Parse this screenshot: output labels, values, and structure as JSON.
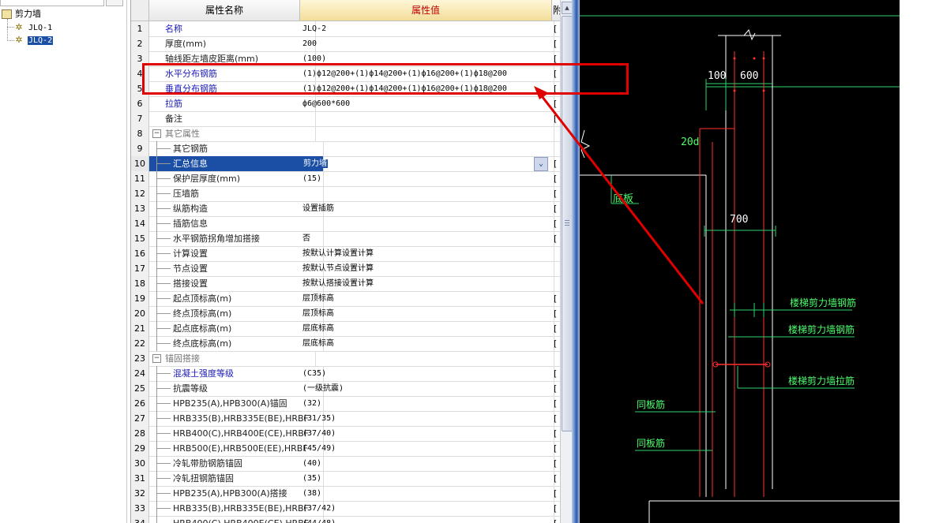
{
  "tree": {
    "root": "剪力墙",
    "children": [
      {
        "label": "JLQ-1",
        "selected": false
      },
      {
        "label": "JLQ-2",
        "selected": true
      }
    ]
  },
  "grid": {
    "headers": {
      "num": "",
      "name": "属性名称",
      "value": "属性值",
      "attach": "附"
    },
    "rows": [
      {
        "n": "1",
        "name": "名称",
        "value": "JLQ-2",
        "style": "blue",
        "level": 0,
        "attach": "["
      },
      {
        "n": "2",
        "name": "厚度(mm)",
        "value": "200",
        "style": "black",
        "level": 0,
        "attach": "["
      },
      {
        "n": "3",
        "name": "轴线距左墙皮距离(mm)",
        "value": "(100)",
        "style": "black",
        "level": 0,
        "attach": "["
      },
      {
        "n": "4",
        "name": "水平分布钢筋",
        "value": "(1)ф12@200+(1)ф14@200+(1)ф16@200+(1)ф18@200",
        "style": "blue",
        "level": 0,
        "attach": "["
      },
      {
        "n": "5",
        "name": "垂直分布钢筋",
        "value": "(1)ф12@200+(1)ф14@200+(1)ф16@200+(1)ф18@200",
        "style": "blue",
        "level": 0,
        "attach": "["
      },
      {
        "n": "6",
        "name": "拉筋",
        "value": "ф6@600*600",
        "style": "blue",
        "level": 0,
        "attach": "["
      },
      {
        "n": "7",
        "name": "备注",
        "value": "",
        "style": "black",
        "level": 0,
        "attach": "["
      },
      {
        "n": "8",
        "name": "其它属性",
        "value": "",
        "style": "gray",
        "level": -1,
        "attach": ""
      },
      {
        "n": "9",
        "name": "其它钢筋",
        "value": "",
        "style": "black",
        "level": 1,
        "attach": ""
      },
      {
        "n": "10",
        "name": "汇总信息",
        "value": "剪力墙",
        "style": "black",
        "level": 1,
        "attach": "[",
        "selected": true
      },
      {
        "n": "11",
        "name": "保护层厚度(mm)",
        "value": "(15)",
        "style": "black",
        "level": 1,
        "attach": "["
      },
      {
        "n": "12",
        "name": "压墙筋",
        "value": "",
        "style": "black",
        "level": 1,
        "attach": "["
      },
      {
        "n": "13",
        "name": "纵筋构造",
        "value": "设置插筋",
        "style": "black",
        "level": 1,
        "attach": "["
      },
      {
        "n": "14",
        "name": "插筋信息",
        "value": "",
        "style": "black",
        "level": 1,
        "attach": "["
      },
      {
        "n": "15",
        "name": "水平钢筋拐角增加搭接",
        "value": "否",
        "style": "black",
        "level": 1,
        "attach": "["
      },
      {
        "n": "16",
        "name": "计算设置",
        "value": "按默认计算设置计算",
        "style": "black",
        "level": 1,
        "attach": ""
      },
      {
        "n": "17",
        "name": "节点设置",
        "value": "按默认节点设置计算",
        "style": "black",
        "level": 1,
        "attach": ""
      },
      {
        "n": "18",
        "name": "搭接设置",
        "value": "按默认搭接设置计算",
        "style": "black",
        "level": 1,
        "attach": ""
      },
      {
        "n": "19",
        "name": "起点顶标高(m)",
        "value": "层顶标高",
        "style": "black",
        "level": 1,
        "attach": "["
      },
      {
        "n": "20",
        "name": "终点顶标高(m)",
        "value": "层顶标高",
        "style": "black",
        "level": 1,
        "attach": "["
      },
      {
        "n": "21",
        "name": "起点底标高(m)",
        "value": "层底标高",
        "style": "black",
        "level": 1,
        "attach": "["
      },
      {
        "n": "22",
        "name": "终点底标高(m)",
        "value": "层底标高",
        "style": "black",
        "level": 1,
        "attach": "["
      },
      {
        "n": "23",
        "name": "锚固搭接",
        "value": "",
        "style": "gray",
        "level": -1,
        "attach": ""
      },
      {
        "n": "24",
        "name": "混凝土强度等级",
        "value": "(C35)",
        "style": "blue",
        "level": 1,
        "attach": "["
      },
      {
        "n": "25",
        "name": "抗震等级",
        "value": "(一级抗震)",
        "style": "black",
        "level": 1,
        "attach": "["
      },
      {
        "n": "26",
        "name": "HPB235(A),HPB300(A)锚固",
        "value": "(32)",
        "style": "black",
        "level": 1,
        "attach": "["
      },
      {
        "n": "27",
        "name": "HRB335(B),HRB335E(BE),HRBF",
        "value": "(31/35)",
        "style": "black",
        "level": 1,
        "attach": "["
      },
      {
        "n": "28",
        "name": "HRB400(C),HRB400E(CE),HRBF",
        "value": "(37/40)",
        "style": "black",
        "level": 1,
        "attach": "["
      },
      {
        "n": "29",
        "name": "HRB500(E),HRB500E(EE),HRBF",
        "value": "(45/49)",
        "style": "black",
        "level": 1,
        "attach": "["
      },
      {
        "n": "30",
        "name": "冷轧带肋钢筋锚固",
        "value": "(40)",
        "style": "black",
        "level": 1,
        "attach": "["
      },
      {
        "n": "31",
        "name": "冷轧扭钢筋锚固",
        "value": "(35)",
        "style": "black",
        "level": 1,
        "attach": "["
      },
      {
        "n": "32",
        "name": "HPB235(A),HPB300(A)搭接",
        "value": "(38)",
        "style": "black",
        "level": 1,
        "attach": "["
      },
      {
        "n": "33",
        "name": "HRB335(B),HRB335E(BE),HRBF",
        "value": "(37/42)",
        "style": "black",
        "level": 1,
        "attach": "["
      },
      {
        "n": "34",
        "name": "HRB400(C),HRB400E(CE),HRBF",
        "value": "(44/48)",
        "style": "black",
        "level": 1,
        "attach": "["
      }
    ]
  },
  "cad": {
    "dim_100": "100",
    "dim_600": "600",
    "dim_20d": "20d",
    "label_floor": "底板",
    "dim_700": "700",
    "note_1": "楼梯剪力墙钢筋",
    "note_2": "楼梯剪力墙钢筋",
    "note_3": "楼梯剪力墙拉筋",
    "note_4": "同板筋",
    "note_5": "同板筋"
  },
  "colors": {
    "selection": "#1b4fa6",
    "highlight_box": "#e00000",
    "cad_bg": "#000000",
    "cad_text": "#4bff6b"
  }
}
